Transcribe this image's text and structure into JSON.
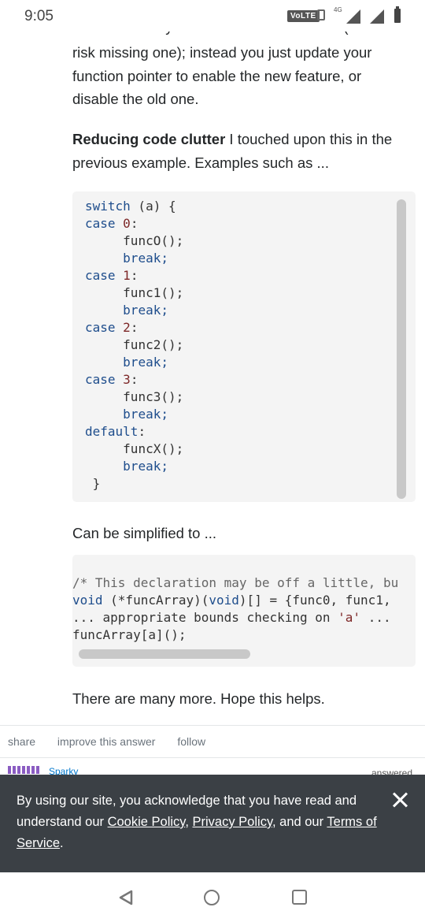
{
  "status_bar": {
    "time": "9:05",
    "volte": "VoLTE",
    "network": "4G"
  },
  "post": {
    "clipped_top_line": "track down all your if else or switch cases (and",
    "paragraph_1": "risk missing one); instead you just update your function pointer to enable the new feature, or disable the old one.",
    "bold_lead": "Reducing code clutter",
    "paragraph_2_rest": " I touched upon this in the previous example. Examples such as ...",
    "code_1": {
      "line_0": {
        "kw": "switch",
        "rest": " (a) {"
      },
      "case0": {
        "kw": "case",
        "num": "0",
        "colon": ":"
      },
      "func0": "funcO();",
      "break0": "break;",
      "case1": {
        "kw": "case",
        "num": "1",
        "colon": ":"
      },
      "func1": "func1();",
      "break1": "break;",
      "case2": {
        "kw": "case",
        "num": "2",
        "colon": ":"
      },
      "func2": "func2();",
      "break2": "break;",
      "case3": {
        "kw": "case",
        "num": "3",
        "colon": ":"
      },
      "func3": "func3();",
      "break3": "break;",
      "default_kw": "default",
      "default_colon": ":",
      "funcx": "funcX();",
      "breakx": "break;",
      "close": "}"
    },
    "simplified_text": "Can be simplified to ...",
    "code_2": {
      "line_1": "/* This declaration may be off a little, bu",
      "line_2_kw1": "void",
      "line_2_mid": " (*funcArray)(",
      "line_2_kw2": "void",
      "line_2_rest": ")[] = {func0, func1,",
      "line_3_a": "... appropriate bounds checking on ",
      "line_3_str": "'a'",
      "line_3_b": " ...",
      "line_4": "funcArray[a]();"
    },
    "closing_text": "There are many more. Hope this helps."
  },
  "post_actions": {
    "share": "share",
    "improve": "improve this answer",
    "follow": "follow"
  },
  "user_row": {
    "name": "Sparky",
    "answered_label": "answered"
  },
  "cookie_banner": {
    "text_1": "By using our site, you acknowledge that you have read and understand our ",
    "cookie_policy": "Cookie Policy",
    "sep_1": ", ",
    "privacy_policy": "Privacy Policy",
    "sep_2": ", and our ",
    "terms": "Terms of Service",
    "end": "."
  },
  "colors": {
    "cookie_bg": "#3b4045",
    "link": "#0077cc",
    "code_bg": "#f4f4f4",
    "keyword": "#1e4d8c",
    "literal": "#7d2727"
  },
  "icons": [
    "vibrate-icon",
    "signal-icon",
    "battery-icon",
    "close-icon",
    "nav-back-icon",
    "nav-home-icon",
    "nav-recent-icon"
  ]
}
